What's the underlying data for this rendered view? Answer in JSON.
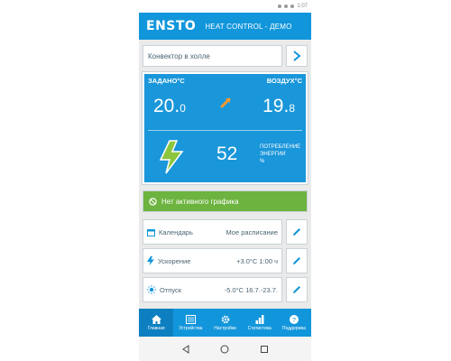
{
  "status": {
    "time": "1:07"
  },
  "header": {
    "logo": "ENSTO",
    "title": "HEAT CONTROL - ДЕМО"
  },
  "device": {
    "name": "Конвектор в холле"
  },
  "panel": {
    "set_label": "ЗАДАНО°C",
    "air_label": "ВОЗДУХ°C",
    "set_int": "20.",
    "set_dec": "0",
    "air_int": "19.",
    "air_dec": "8",
    "energy_value": "52",
    "energy_label_1": "ПОТРЕБЛЕНИЕ",
    "energy_label_2": "ЭНЕРГИИ",
    "energy_label_3": "%"
  },
  "schedule_status": "Нет активного графика",
  "rows": [
    {
      "label": "Календарь",
      "value": "Мое расписание",
      "icon": "calendar-icon"
    },
    {
      "label": "Ускорение",
      "value": "+3.0°C 1:00 ч",
      "icon": "bolt-icon"
    },
    {
      "label": "Отпуск",
      "value": "-5.0°C 16.7.-23.7.",
      "icon": "sun-icon"
    }
  ],
  "nav": [
    {
      "label": "Главная",
      "icon": "home-icon",
      "active": true
    },
    {
      "label": "Устройства",
      "icon": "devices-icon"
    },
    {
      "label": "Настройки",
      "icon": "gear-icon"
    },
    {
      "label": "Статистика",
      "icon": "bar-chart-icon"
    },
    {
      "label": "Поддержка",
      "icon": "help-icon"
    }
  ],
  "colors": {
    "primary": "#1296db",
    "active_nav": "#0d7fc1",
    "schedule": "#6db33f",
    "arrow": "#f39a2b",
    "bolt": "#8cc63f"
  }
}
